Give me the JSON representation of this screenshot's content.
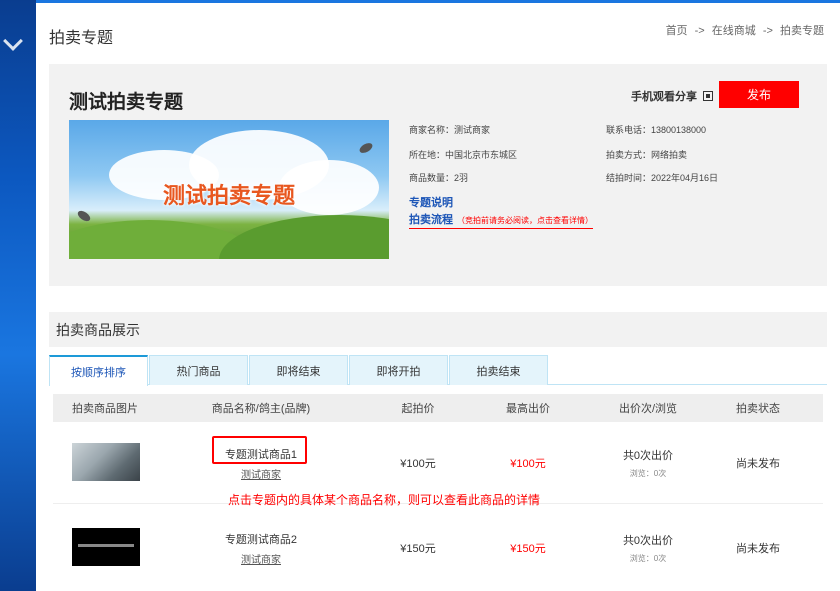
{
  "page": {
    "title": "拍卖专题"
  },
  "breadcrumb": {
    "home": "首页",
    "sep": "->",
    "mall": "在线商城",
    "current": "拍卖专题"
  },
  "topic": {
    "title": "测试拍卖专题",
    "share_label": "手机观看分享",
    "publish_label": "发布",
    "banner_text": "测试拍卖专题",
    "info": {
      "merchant": "商家名称：测试商家",
      "phone": "联系电话：13800138000",
      "location": "所在地：中国北京市东城区",
      "method": "拍卖方式：网络拍卖",
      "count": "商品数量：2羽",
      "end_time": "结拍时间：2022年04月16日",
      "desc_link": "专题说明",
      "process_link": "拍卖流程",
      "process_note": "（竞拍前请务必阅读，点击查看详情）"
    }
  },
  "goods": {
    "heading": "拍卖商品展示",
    "tabs": [
      "按顺序排序",
      "热门商品",
      "即将结束",
      "即将开拍",
      "拍卖结束"
    ],
    "columns": [
      "拍卖商品图片",
      "商品名称/鸽主(品牌)",
      "起拍价",
      "最高出价",
      "出价次/浏览",
      "拍卖状态"
    ],
    "rows": [
      {
        "name": "专题测试商品1",
        "owner": "测试商家",
        "start_price": "¥100元",
        "max_bid": "¥100元",
        "bids": "共0次出价",
        "views": "浏览：0次",
        "status": "尚未发布"
      },
      {
        "name": "专题测试商品2",
        "owner": "测试商家",
        "start_price": "¥150元",
        "max_bid": "¥150元",
        "bids": "共0次出价",
        "views": "浏览：0次",
        "status": "尚未发布"
      }
    ]
  },
  "annotation": {
    "text": "点击专题内的具体某个商品名称，则可以查看此商品的详情"
  },
  "colors": {
    "accent": "#ff0000",
    "link": "#1d56b7",
    "tab_bg": "#e4f4fb",
    "panel_bg": "#f2f2f2"
  }
}
